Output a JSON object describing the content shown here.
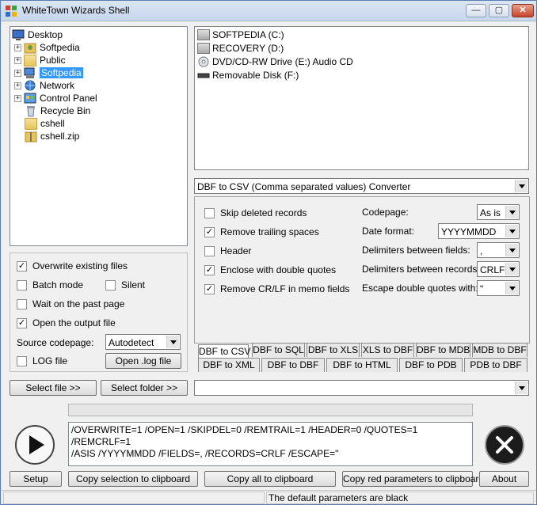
{
  "window": {
    "title": "WhiteTown Wizards Shell"
  },
  "titlebar_buttons": {
    "minimize": "—",
    "maximize": "▢",
    "close": "✕"
  },
  "tree": [
    {
      "label": "Desktop",
      "icon": "desktop-icon"
    },
    {
      "label": "Softpedia",
      "icon": "user-folder-icon"
    },
    {
      "label": "Public",
      "icon": "folder-icon"
    },
    {
      "label": "Softpedia",
      "icon": "computer-icon",
      "selected": true
    },
    {
      "label": "Network",
      "icon": "network-icon"
    },
    {
      "label": "Control Panel",
      "icon": "control-panel-icon"
    },
    {
      "label": "Recycle Bin",
      "icon": "recycle-bin-icon"
    },
    {
      "label": "cshell",
      "icon": "folder-icon"
    },
    {
      "label": "cshell.zip",
      "icon": "zip-folder-icon"
    }
  ],
  "drives": [
    {
      "label": "SOFTPEDIA (C:)",
      "icon": "hard-drive-icon"
    },
    {
      "label": "RECOVERY (D:)",
      "icon": "hard-drive-icon"
    },
    {
      "label": "DVD/CD-RW Drive (E:) Audio CD",
      "icon": "cd-drive-icon"
    },
    {
      "label": "Removable Disk (F:)",
      "icon": "removable-disk-icon"
    }
  ],
  "converter": {
    "selected": "DBF to CSV (Comma separated values) Converter"
  },
  "options": {
    "skip_deleted": {
      "label": "Skip deleted records",
      "checked": false
    },
    "remove_trailing": {
      "label": "Remove trailing spaces",
      "checked": true
    },
    "header": {
      "label": "Header",
      "checked": false
    },
    "enclose_quotes": {
      "label": "Enclose with double quotes",
      "checked": true
    },
    "remove_crlf": {
      "label": "Remove CR/LF in memo fields",
      "checked": true
    },
    "codepage_label": "Codepage:",
    "codepage_value": "As is",
    "date_format_label": "Date format:",
    "date_format_value": "YYYYMMDD",
    "delim_fields_label": "Delimiters between fields:",
    "delim_fields_value": ",",
    "delim_records_label": "Delimiters between records:",
    "delim_records_value": "CRLF",
    "escape_label": "Escape double quotes with:",
    "escape_value": "\""
  },
  "tabs_row1": [
    "DBF to CSV",
    "DBF to SQL",
    "DBF to XLS",
    "XLS to DBF",
    "DBF to MDB",
    "MDB to DBF"
  ],
  "tabs_row2": [
    "DBF to XML",
    "DBF to DBF",
    "DBF to HTML",
    "DBF to PDB",
    "PDB to DBF"
  ],
  "left_options": {
    "overwrite": {
      "label": "Overwrite existing files",
      "checked": true
    },
    "batch": {
      "label": "Batch mode",
      "checked": false
    },
    "silent": {
      "label": "Silent",
      "checked": false
    },
    "wait": {
      "label": "Wait on the past page",
      "checked": false
    },
    "open_output": {
      "label": "Open the output file",
      "checked": true
    },
    "source_codepage_label": "Source codepage:",
    "source_codepage_value": "Autodetect",
    "log": {
      "label": "LOG file",
      "checked": false
    },
    "open_log_button": "Open .log file"
  },
  "buttons": {
    "select_file": "Select file >>",
    "select_folder": "Select folder >>",
    "setup": "Setup",
    "copy_selection": "Copy selection to clipboard",
    "copy_all": "Copy all to clipboard",
    "copy_red": "Copy red parameters to clipboard",
    "about": "About"
  },
  "command_line": {
    "line1": "/OVERWRITE=1 /OPEN=1  /SKIPDEL=0 /REMTRAIL=1 /HEADER=0 /QUOTES=1 /REMCRLF=1",
    "line2": "/ASIS /YYYYMMDD /FIELDS=, /RECORDS=CRLF /ESCAPE=\""
  },
  "status": {
    "text": "The default parameters are black"
  },
  "colors": {
    "selection": "#3399ff",
    "window_bg": "#f0f0f0"
  }
}
